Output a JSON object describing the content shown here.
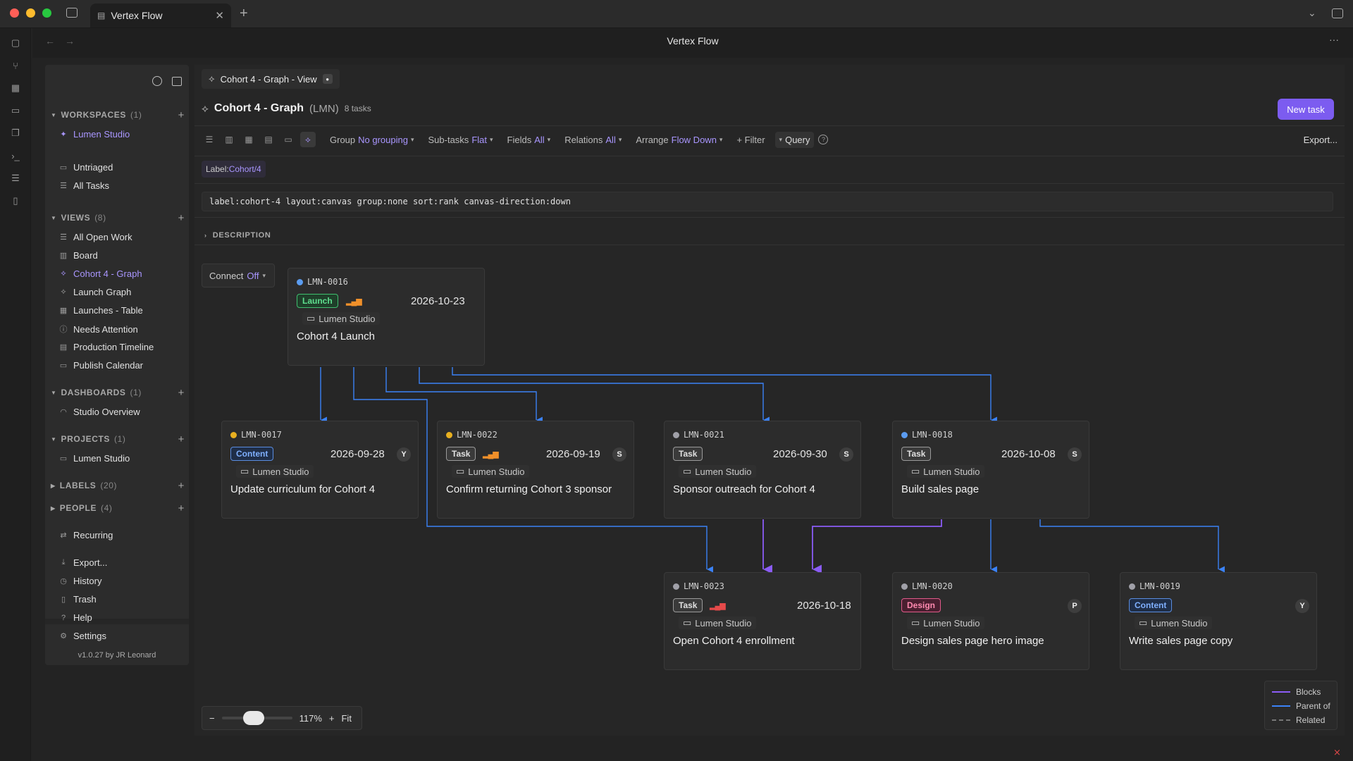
{
  "window": {
    "tab_title": "Vertex Flow",
    "app_title": "Vertex Flow"
  },
  "sidebar": {
    "workspaces": {
      "label": "WORKSPACES",
      "count": "(1)",
      "items": [
        {
          "label": "Lumen Studio",
          "icon": "workspace-icon"
        }
      ]
    },
    "quick": [
      {
        "label": "Untriaged",
        "icon": "inbox-icon"
      },
      {
        "label": "All Tasks",
        "icon": "list-icon"
      }
    ],
    "views": {
      "label": "VIEWS",
      "count": "(8)",
      "items": [
        {
          "label": "All Open Work",
          "icon": "list-icon"
        },
        {
          "label": "Board",
          "icon": "board-icon"
        },
        {
          "label": "Cohort 4 - Graph",
          "icon": "graph-icon",
          "active": true
        },
        {
          "label": "Launch Graph",
          "icon": "graph-icon"
        },
        {
          "label": "Launches - Table",
          "icon": "table-icon"
        },
        {
          "label": "Needs Attention",
          "icon": "alert-icon"
        },
        {
          "label": "Production Timeline",
          "icon": "timeline-icon"
        },
        {
          "label": "Publish Calendar",
          "icon": "calendar-icon"
        }
      ]
    },
    "dashboards": {
      "label": "DASHBOARDS",
      "count": "(1)",
      "items": [
        {
          "label": "Studio Overview",
          "icon": "gauge-icon"
        }
      ]
    },
    "projects": {
      "label": "PROJECTS",
      "count": "(1)",
      "items": [
        {
          "label": "Lumen Studio",
          "icon": "folder-icon"
        }
      ]
    },
    "labels": {
      "label": "LABELS",
      "count": "(20)"
    },
    "people": {
      "label": "PEOPLE",
      "count": "(4)"
    },
    "misc": [
      {
        "label": "Recurring",
        "icon": "repeat-icon"
      },
      {
        "label": "Export...",
        "icon": "download-icon"
      },
      {
        "label": "History",
        "icon": "history-icon"
      },
      {
        "label": "Trash",
        "icon": "trash-icon"
      }
    ],
    "footer": [
      {
        "label": "Help",
        "icon": "help-icon"
      },
      {
        "label": "Settings",
        "icon": "gear-icon"
      }
    ],
    "version": "v1.0.27 by JR Leonard"
  },
  "main": {
    "view_tab": "Cohort 4 - Graph - View",
    "title": "Cohort 4 - Graph",
    "key": "(LMN)",
    "task_count": "8 tasks",
    "new_task": "New task",
    "toolbar": {
      "group_label": "Group",
      "group_value": "No grouping",
      "subtasks_label": "Sub-tasks",
      "subtasks_value": "Flat",
      "fields_label": "Fields",
      "fields_value": "All",
      "relations_label": "Relations",
      "relations_value": "All",
      "arrange_label": "Arrange",
      "arrange_value": "Flow Down",
      "filter": "+ Filter",
      "query": "Query",
      "export": "Export..."
    },
    "label_chip": {
      "key": "Label:",
      "value": "Cohort/4"
    },
    "query_text": "label:cohort-4 layout:canvas group:none sort:rank canvas-direction:down",
    "description": "DESCRIPTION",
    "connect": {
      "label": "Connect",
      "value": "Off"
    },
    "zoom": {
      "value": "117%",
      "fit": "Fit",
      "slider_fraction": 0.45
    },
    "legend": {
      "blocks": "Blocks",
      "parent_of": "Parent of",
      "related": "Related"
    }
  },
  "colors": {
    "accent": "#7c5cf0",
    "accent_text": "#a996ff",
    "parent_line": "#3b82f6",
    "blocks_line": "#8b5cf6"
  },
  "cards": [
    {
      "id": "LMN-0016",
      "dot": "#5b9cf0",
      "badge": "Launch",
      "badge_type": "launch",
      "prio": "orange",
      "date": "2026-10-23",
      "avatar": "",
      "project": "Lumen Studio",
      "title": "Cohort 4 Launch"
    },
    {
      "id": "LMN-0017",
      "dot": "#e8b020",
      "badge": "Content",
      "badge_type": "content",
      "prio": "",
      "date": "2026-09-28",
      "avatar": "Y",
      "project": "Lumen Studio",
      "title": "Update curriculum for Cohort 4"
    },
    {
      "id": "LMN-0022",
      "dot": "#e8b020",
      "badge": "Task",
      "badge_type": "task",
      "prio": "orange",
      "date": "2026-09-19",
      "avatar": "S",
      "project": "Lumen Studio",
      "title": "Confirm returning Cohort 3 sponsor"
    },
    {
      "id": "LMN-0021",
      "dot": "#a0a0a8",
      "badge": "Task",
      "badge_type": "task",
      "prio": "",
      "date": "2026-09-30",
      "avatar": "S",
      "project": "Lumen Studio",
      "title": "Sponsor outreach for Cohort 4"
    },
    {
      "id": "LMN-0018",
      "dot": "#5b9cf0",
      "badge": "Task",
      "badge_type": "task",
      "prio": "",
      "date": "2026-10-08",
      "avatar": "S",
      "project": "Lumen Studio",
      "title": "Build sales page"
    },
    {
      "id": "LMN-0023",
      "dot": "#a0a0a8",
      "badge": "Task",
      "badge_type": "task",
      "prio": "red",
      "date": "2026-10-18",
      "avatar": "",
      "project": "Lumen Studio",
      "title": "Open Cohort 4 enrollment"
    },
    {
      "id": "LMN-0020",
      "dot": "#a0a0a8",
      "badge": "Design",
      "badge_type": "design",
      "prio": "",
      "date": "",
      "avatar": "P",
      "project": "Lumen Studio",
      "title": "Design sales page hero image"
    },
    {
      "id": "LMN-0019",
      "dot": "#a0a0a8",
      "badge": "Content",
      "badge_type": "content",
      "prio": "",
      "date": "",
      "avatar": "Y",
      "project": "Lumen Studio",
      "title": "Write sales page copy"
    }
  ]
}
